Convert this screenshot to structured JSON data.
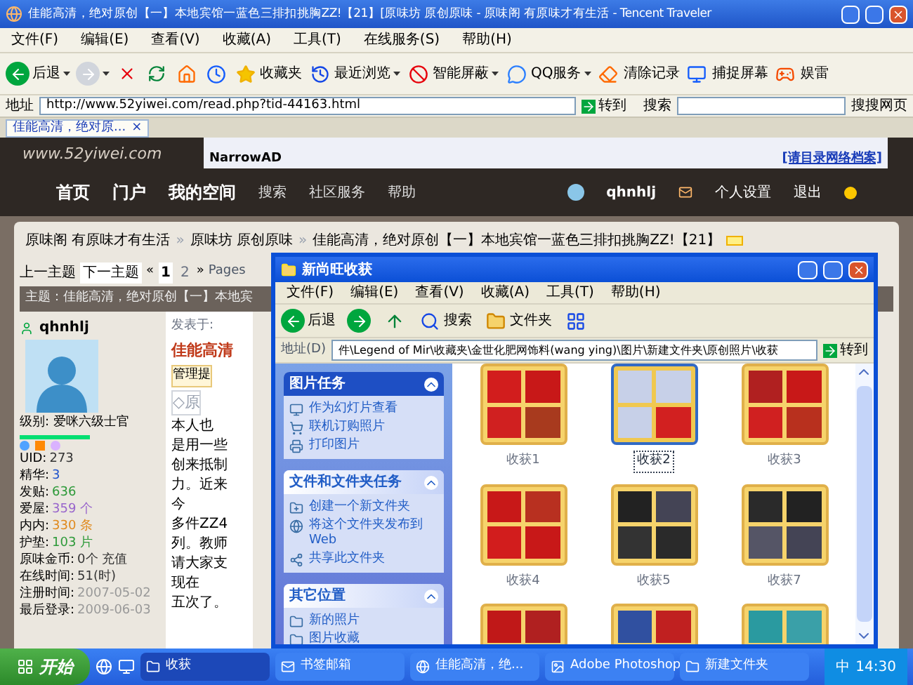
{
  "browser": {
    "title": "佳能高清，绝对原创【一】本地宾馆一蓝色三排扣挑胸ZZ!【21】[原味坊 原创原味 - 原味阁 有原味才有生活 - Tencent Traveler",
    "menu": [
      "文件(F)",
      "编辑(E)",
      "查看(V)",
      "收藏(A)",
      "工具(T)",
      "在线服务(S)",
      "帮助(H)"
    ],
    "toolbar": [
      {
        "kind": "back",
        "label": "后退",
        "dropdown": true
      },
      {
        "kind": "forward",
        "dropdown": true
      },
      {
        "kind": "stop",
        "dropdown": false
      },
      {
        "kind": "refresh",
        "dropdown": false
      },
      {
        "kind": "home",
        "dropdown": false
      },
      {
        "kind": "history",
        "dropdown": false
      },
      {
        "kind": "favorites",
        "label": "收藏夹",
        "dropdown": false
      },
      {
        "kind": "recent",
        "label": "最近浏览",
        "dropdown": true
      },
      {
        "kind": "block",
        "label": "智能屏蔽",
        "dropdown": true
      },
      {
        "kind": "qq",
        "label": "QQ服务",
        "dropdown": true
      },
      {
        "kind": "clear",
        "label": "清除记录",
        "dropdown": false
      },
      {
        "kind": "capture",
        "label": "捕捉屏幕",
        "dropdown": false
      },
      {
        "kind": "game",
        "label": "娱雷",
        "dropdown": false
      }
    ],
    "address": {
      "label": "地址",
      "url": "http://www.52yiwei.com/read.php?tid-44163.html",
      "go": "转到"
    },
    "search": {
      "label": "搜索",
      "engine": "搜搜网页"
    },
    "tab": {
      "label": "佳能高清，绝对原...",
      "close": "×"
    }
  },
  "forum": {
    "logo": "www.52yiwei.com",
    "ad": {
      "label": "NarrowAD",
      "link": "[请目录网络档案]"
    },
    "nav": {
      "main": [
        "首页",
        "门户",
        "我的空间"
      ],
      "sub": [
        "搜索",
        "社区服务",
        "帮助"
      ],
      "user": "qhnhlj",
      "settings": "个人设置",
      "logout": "退出"
    },
    "breadcrumb": {
      "separator": "»",
      "items": [
        "原味阁 有原味才有生活",
        "原味坊 原创原味",
        "佳能高清，绝对原创【一】本地宾馆一蓝色三排扣挑胸ZZ!【21】"
      ]
    },
    "pager": {
      "prev": "上一主题",
      "next": "下一主题",
      "first": "«",
      "last": "»",
      "more": "Pages",
      "pages": [
        {
          "label": "1",
          "selected": true
        },
        {
          "label": "2",
          "selected": false
        }
      ]
    },
    "subject": "主题：佳能高清，绝对原创【一】本地宾",
    "author": {
      "name": "qhnhlj",
      "level": "级别: 爱咪六级士官",
      "stats": [
        {
          "label": "UID:",
          "value": "273",
          "color": "#333333"
        },
        {
          "label": "精华:",
          "value": "3",
          "color": "#2255cc"
        },
        {
          "label": "发贴:",
          "value": "636",
          "color": "#2e9a3a"
        },
        {
          "label": "爱屋:",
          "value": "359 个",
          "color": "#9966cc"
        },
        {
          "label": "内内:",
          "value": "330 条",
          "color": "#e08a1e"
        },
        {
          "label": "护垫:",
          "value": "103 片",
          "color": "#2e9a3a"
        },
        {
          "label": "原味金币:",
          "value": "0个 充值",
          "color": "#333333"
        },
        {
          "label": "在线时间:",
          "value": "51(时)",
          "color": "#333333"
        },
        {
          "label": "注册时间:",
          "value": "2007-05-02",
          "color": "#999999"
        },
        {
          "label": "最后登录:",
          "value": "2009-06-03",
          "color": "#999999"
        }
      ]
    },
    "post": {
      "posted": "发表于:",
      "title": "佳能高清",
      "notice": "管理提",
      "tag": "◇原",
      "lines": [
        "本人也",
        "是用一些",
        "创来抵制",
        "力。近来",
        "今",
        "多件ZZ4",
        "列。教师",
        "请大家支",
        "现在",
        "五次了。"
      ]
    }
  },
  "explorer": {
    "title": "新尚旺收获",
    "menu": [
      "文件(F)",
      "编辑(E)",
      "查看(V)",
      "收藏(A)",
      "工具(T)",
      "帮助(H)"
    ],
    "toolbar": [
      {
        "kind": "back",
        "label": "后退"
      },
      {
        "kind": "forward"
      },
      {
        "kind": "up"
      },
      {
        "kind": "search",
        "label": "搜索"
      },
      {
        "kind": "folders",
        "label": "文件夹"
      },
      {
        "kind": "views"
      }
    ],
    "address": {
      "label": "地址(D)",
      "path": "件\\Legend of Mir\\收藏夹\\金世化肥网饰料(wang ying)\\图片\\新建文件夹\\原创照片\\收获",
      "go": "转到"
    },
    "panels": [
      {
        "kind": "picture",
        "title": "图片任务",
        "items": [
          {
            "kind": "slideshow",
            "label": "作为幻灯片查看"
          },
          {
            "kind": "order",
            "label": "联机订购照片"
          },
          {
            "kind": "print",
            "label": "打印图片"
          }
        ]
      },
      {
        "kind": "file",
        "title": "文件和文件夹任务",
        "items": [
          {
            "kind": "newfolder",
            "label": "创建一个新文件夹"
          },
          {
            "kind": "web",
            "label": "将这个文件夹发布到 Web"
          },
          {
            "kind": "share",
            "label": "共享此文件夹"
          }
        ]
      },
      {
        "kind": "other",
        "title": "其它位置",
        "items": [
          {
            "kind": "folder",
            "label": "新的照片"
          },
          {
            "kind": "folder",
            "label": "图片收藏"
          }
        ]
      }
    ],
    "files": [
      {
        "label": "收获1",
        "selected": false
      },
      {
        "label": "收获2",
        "selected": true
      },
      {
        "label": "收获3",
        "selected": false
      },
      {
        "label": "收获4",
        "selected": false
      },
      {
        "label": "收获5",
        "selected": false
      },
      {
        "label": "收获7",
        "selected": false
      },
      {
        "selected": false
      },
      {
        "selected": false
      },
      {
        "selected": false
      }
    ]
  },
  "taskbar": {
    "start": "开始",
    "tasks": [
      {
        "kind": "folder",
        "label": "收获",
        "selected": true
      },
      {
        "kind": "mail",
        "label": "书签邮箱",
        "selected": false
      },
      {
        "kind": "browser",
        "label": "佳能高清，绝...",
        "selected": false
      },
      {
        "kind": "ps",
        "label": "Adobe Photoshop",
        "selected": false
      },
      {
        "kind": "folder",
        "label": "新建文件夹",
        "selected": false
      }
    ],
    "ime": "中",
    "time": "14:30"
  }
}
